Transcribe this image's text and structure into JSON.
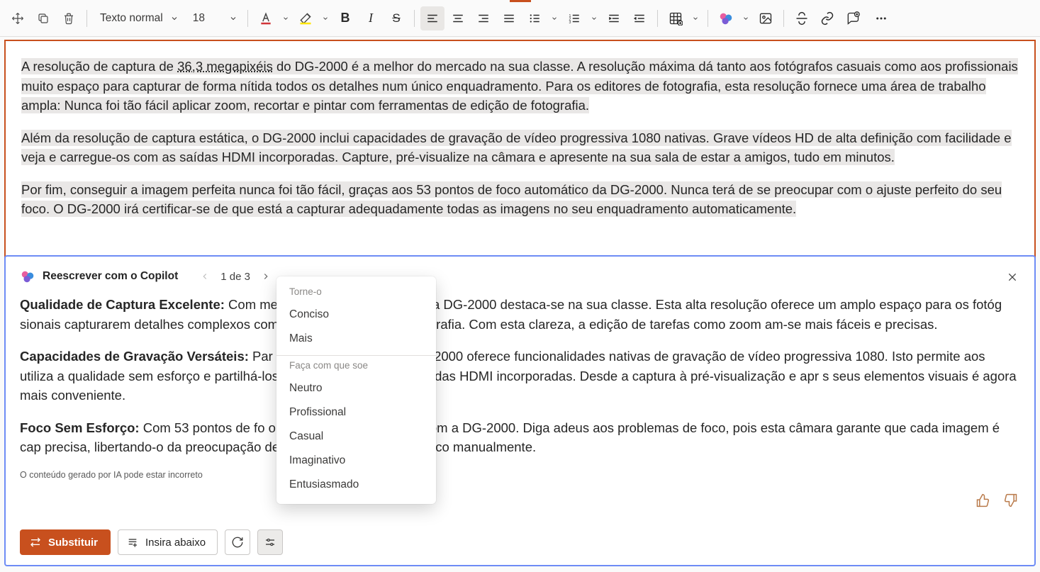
{
  "toolbar": {
    "style_name": "Texto normal",
    "font_size": "18"
  },
  "document": {
    "p1_pre": "A resolução de captura de ",
    "p1_link": "36,3 megapixéis",
    "p1_post": " do DG-2000 é a melhor do mercado na sua classe. A resolução máxima dá tanto aos fotógrafos casuais como aos profissionais muito espaço para capturar de forma nítida todos os detalhes num único enquadramento. Para os editores de fotografia, esta resolução fornece uma área de trabalho ampla: Nunca foi tão fácil aplicar zoom, recortar e pintar com ferramentas de edição de fotografia.",
    "p2": "Além da resolução de captura estática, o DG-2000 inclui capacidades de gravação de vídeo progressiva 1080 nativas. Grave vídeos HD de alta definição com facilidade e veja e carregue-os com as saídas HDMI incorporadas. Capture, pré-visualize na câmara e apresente na sua sala de estar a amigos, tudo em minutos.",
    "p3": "Por fim, conseguir a imagem perfeita nunca foi tão fácil, graças aos 53 pontos de foco automático da DG-2000. Nunca terá de se preocupar com o ajuste perfeito do seu foco. O DG-2000 irá certificar-se de que está a capturar adequadamente todas as imagens no seu enquadramento automaticamente."
  },
  "panel": {
    "title": "Reescrever com o Copilot",
    "pager": "1 de 3",
    "s1_title": "Qualidade de Captura Excelente:",
    "s1_text": " Com                                                     megapixéis de alta definição, a DG-2000 destaca-se na sua classe. Esta alta resolução oferece um amplo espaço para os fotóg                                           sionais capturarem detalhes complexos com precisão numa única fotografia. Com esta clareza, a edição de tarefas como zoom                                            am-se mais fáceis e precisas.",
    "s2_title": "Capacidades de Gravação Versáteis:",
    "s2_text": " Par                                            de imagem superior, a DG-2000 oferece funcionalidades nativas de gravação de vídeo progressiva 1080. Isto permite aos utiliza                                         a qualidade sem esforço e partilhá-los facilmente através das saídas HDMI incorporadas. Desde a captura à pré-visualização e apr                                       s seus elementos visuais é agora mais conveniente.",
    "s3_title": "Foco Sem Esforço:",
    "s3_text": " Com 53 pontos de fo                                         o momento perfeito é fácil com a DG-2000. Diga adeus aos problemas de foco, pois esta câmara garante que cada imagem é cap                                         precisa, libertando-o da preocupação de ajustar as definições de foco manualmente.",
    "disclaimer": "O conteúdo gerado por IA pode estar incorreto",
    "replace_btn": "Substituir",
    "insert_btn": "Insira abaixo"
  },
  "tone_menu": {
    "head1": "Torne-o",
    "concise": "Conciso",
    "more": "Mais",
    "head2": "Faça com que soe",
    "neutral": "Neutro",
    "professional": "Profissional",
    "casual": "Casual",
    "imaginative": "Imaginativo",
    "enthusiastic": "Entusiasmado"
  }
}
